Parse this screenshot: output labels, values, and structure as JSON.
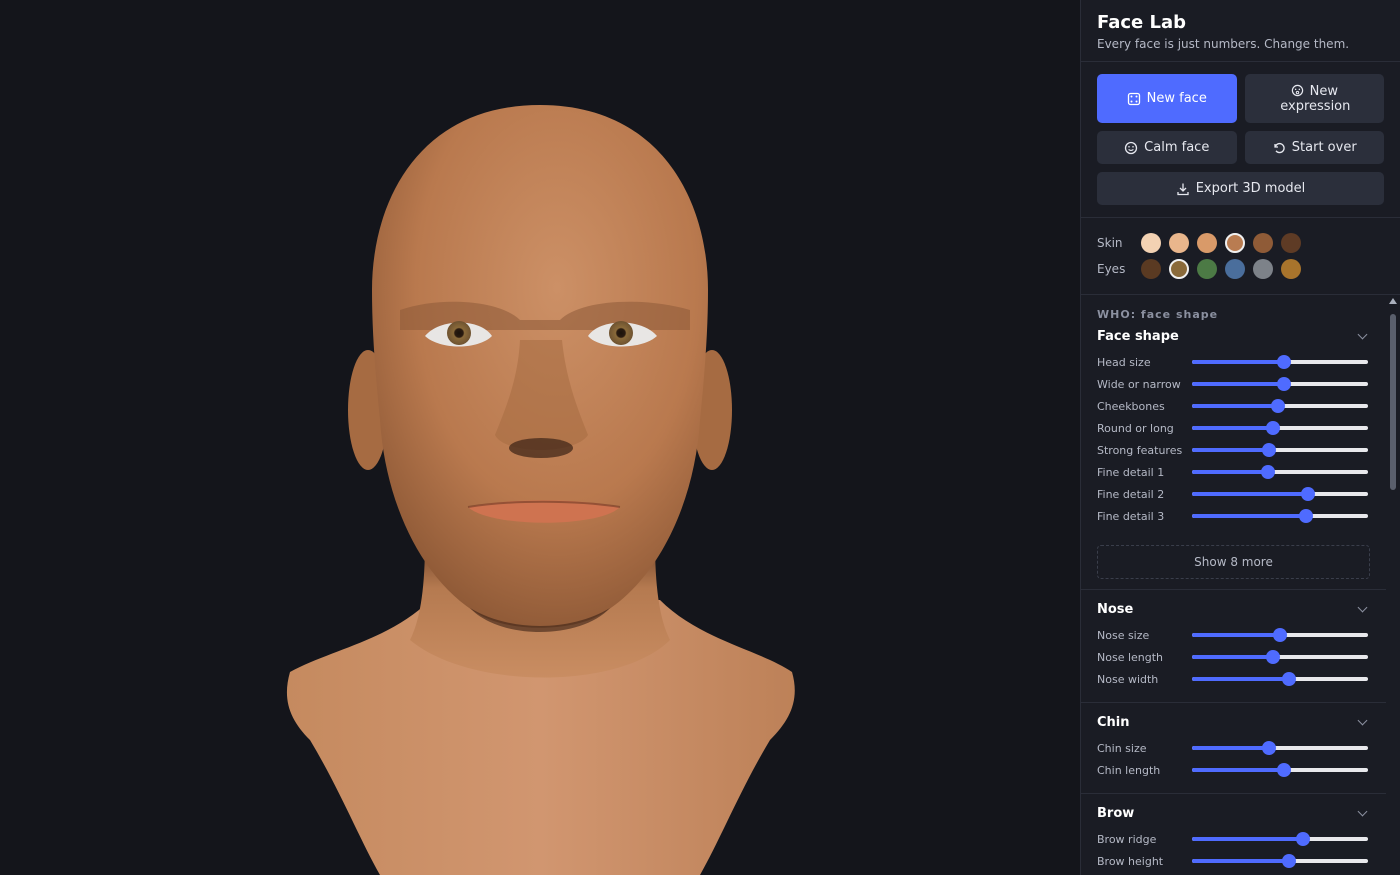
{
  "app": {
    "title": "Face Lab",
    "subtitle": "Every face is just numbers. Change them."
  },
  "actions": {
    "new_face": "New face",
    "new_expression": "New expression",
    "calm_face": "Calm face",
    "start_over": "Start over",
    "export": "Export 3D model"
  },
  "colors": {
    "accent": "#4f6bff",
    "panel_bg": "#1a1c24",
    "viewport_bg": "#14151b"
  },
  "skin": {
    "label": "Skin",
    "options": [
      "#f3d2b3",
      "#e9b68c",
      "#d99a69",
      "#b97c51",
      "#8f5b37",
      "#5e3b25"
    ],
    "selected": 3
  },
  "eyes": {
    "label": "Eyes",
    "options": [
      "#5a3a22",
      "#8a6a3a",
      "#4c7a45",
      "#4a6e9c",
      "#7d8289",
      "#a8742c"
    ],
    "selected": 1
  },
  "group_caption": "WHO: face shape",
  "sections": {
    "face_shape": {
      "title": "Face shape",
      "more_label": "Show 8 more",
      "sliders": [
        {
          "label": "Head size",
          "value": 0.52
        },
        {
          "label": "Wide or narrow",
          "value": 0.52
        },
        {
          "label": "Cheekbones",
          "value": 0.49
        },
        {
          "label": "Round or long",
          "value": 0.46
        },
        {
          "label": "Strong features",
          "value": 0.44
        },
        {
          "label": "Fine detail 1",
          "value": 0.43
        },
        {
          "label": "Fine detail 2",
          "value": 0.66
        },
        {
          "label": "Fine detail 3",
          "value": 0.65
        }
      ]
    },
    "nose": {
      "title": "Nose",
      "sliders": [
        {
          "label": "Nose size",
          "value": 0.5
        },
        {
          "label": "Nose length",
          "value": 0.46
        },
        {
          "label": "Nose width",
          "value": 0.55
        }
      ]
    },
    "chin": {
      "title": "Chin",
      "sliders": [
        {
          "label": "Chin size",
          "value": 0.44
        },
        {
          "label": "Chin length",
          "value": 0.52
        }
      ]
    },
    "brow": {
      "title": "Brow",
      "sliders": [
        {
          "label": "Brow ridge",
          "value": 0.63
        },
        {
          "label": "Brow height",
          "value": 0.55
        }
      ]
    }
  },
  "icons": {
    "new_face": "dice-icon",
    "new_expression": "face-icon",
    "calm_face": "smile-icon",
    "start_over": "rotate-ccw-icon",
    "export": "download-icon"
  }
}
